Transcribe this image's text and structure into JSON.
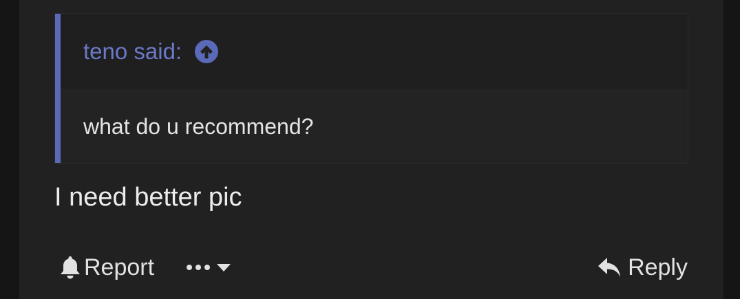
{
  "quote": {
    "author_label": "teno said:",
    "body": "what do u recommend?"
  },
  "message": {
    "text": "I need better pic"
  },
  "actions": {
    "report_label": "Report",
    "reply_label": "Reply"
  },
  "icons": {
    "jump": "arrow-up-circle-icon",
    "report": "bell-icon",
    "more": "ellipsis-icon",
    "caret": "chevron-down-icon",
    "reply": "reply-arrow-icon"
  },
  "colors": {
    "accent": "#5a6ab8",
    "link": "#6b79c9",
    "background": "#212121"
  }
}
